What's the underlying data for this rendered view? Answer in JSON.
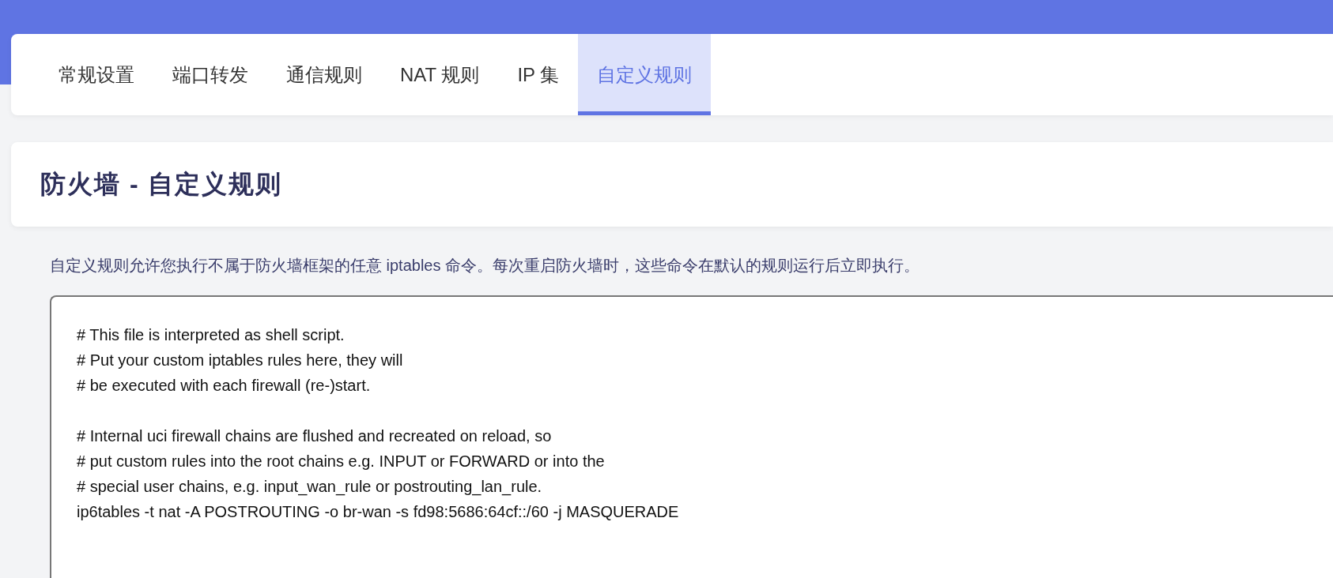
{
  "tabs": [
    {
      "label": "常规设置",
      "selected": false
    },
    {
      "label": "端口转发",
      "selected": false
    },
    {
      "label": "通信规则",
      "selected": false
    },
    {
      "label": "NAT 规则",
      "selected": false
    },
    {
      "label": "IP 集",
      "selected": false
    },
    {
      "label": "自定义规则",
      "selected": true
    }
  ],
  "page_title": "防火墙 - 自定义规则",
  "description": "自定义规则允许您执行不属于防火墙框架的任意 iptables 命令。每次重启防火墙时，这些命令在默认的规则运行后立即执行。",
  "editor": {
    "value": "# This file is interpreted as shell script.\n# Put your custom iptables rules here, they will\n# be executed with each firewall (re-)start.\n\n# Internal uci firewall chains are flushed and recreated on reload, so\n# put custom rules into the root chains e.g. INPUT or FORWARD or into the\n# special user chains, e.g. input_wan_rule or postrouting_lan_rule.\nip6tables -t nat -A POSTROUTING -o br-wan -s fd98:5686:64cf::/60 -j MASQUERADE"
  }
}
